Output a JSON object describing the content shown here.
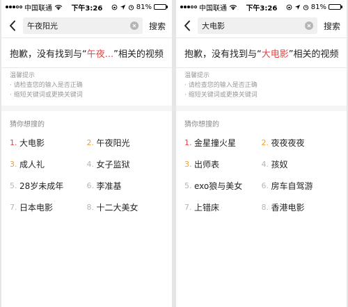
{
  "colors": {
    "accent_red": "#e64340",
    "accent_orange": "#f0a030",
    "rank_gray": "#b5b5b5"
  },
  "screens": [
    {
      "status": {
        "carrier": "中国联通",
        "time": "下午3:26",
        "battery": "81%"
      },
      "search": {
        "value": "午夜阳光",
        "button": "搜索"
      },
      "message": {
        "before": "抱歉，没有找到与“",
        "keyword": "午夜...",
        "after": "”相关的视频"
      },
      "tips": {
        "title": "温馨提示",
        "items": [
          "· 请检查您的输入是否正确",
          "· 缩短关键词或更换关键词"
        ]
      },
      "guess": {
        "title": "猜你想搜的",
        "items": [
          {
            "rank": "1.",
            "label": "大电影"
          },
          {
            "rank": "2.",
            "label": "午夜阳光"
          },
          {
            "rank": "3.",
            "label": "成人礼"
          },
          {
            "rank": "4.",
            "label": "女子监狱"
          },
          {
            "rank": "5.",
            "label": "28岁未成年"
          },
          {
            "rank": "6.",
            "label": "李准基"
          },
          {
            "rank": "7.",
            "label": "日本电影"
          },
          {
            "rank": "8.",
            "label": "十二大美女"
          }
        ]
      }
    },
    {
      "status": {
        "carrier": "中国联通",
        "time": "下午3:26",
        "battery": "81%"
      },
      "search": {
        "value": "大电影",
        "button": "搜索"
      },
      "message": {
        "before": "抱歉，没有找到与“",
        "keyword": "大电影",
        "after": "”相关的视频"
      },
      "tips": {
        "title": "温馨提示",
        "items": [
          "· 请检查您的输入是否正确",
          "· 缩短关键词或更换关键词"
        ]
      },
      "guess": {
        "title": "猜你想搜的",
        "items": [
          {
            "rank": "1.",
            "label": "金星撞火星"
          },
          {
            "rank": "2.",
            "label": "夜夜夜夜"
          },
          {
            "rank": "3.",
            "label": "出师表"
          },
          {
            "rank": "4.",
            "label": "孩奴"
          },
          {
            "rank": "5.",
            "label": "exo狼与美女"
          },
          {
            "rank": "6.",
            "label": "房车自驾游"
          },
          {
            "rank": "7.",
            "label": "上错床"
          },
          {
            "rank": "8.",
            "label": "香港电影"
          }
        ]
      }
    }
  ]
}
